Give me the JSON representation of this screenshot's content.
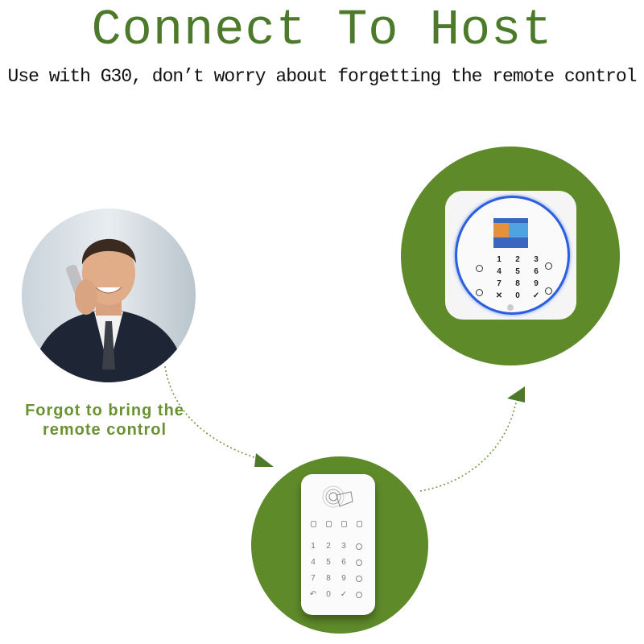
{
  "header": {
    "title": "Connect To Host",
    "subtitle": "Use with G30, don’t worry about forgetting the remote control"
  },
  "caption": {
    "line1": "Forgot to bring the",
    "line2": "remote control"
  },
  "colors": {
    "accent": "#5f8a2a",
    "title": "#4d7a2a",
    "caption": "#6a9233",
    "ring": "#2c5ee0"
  },
  "host_keypad": [
    "1",
    "2",
    "3",
    "4",
    "5",
    "6",
    "7",
    "8",
    "9",
    "✕",
    "0",
    "✓"
  ],
  "remote_keypad": [
    "1",
    "2",
    "3",
    "4",
    "5",
    "6",
    "7",
    "8",
    "9",
    "↶",
    "0",
    "✓"
  ]
}
